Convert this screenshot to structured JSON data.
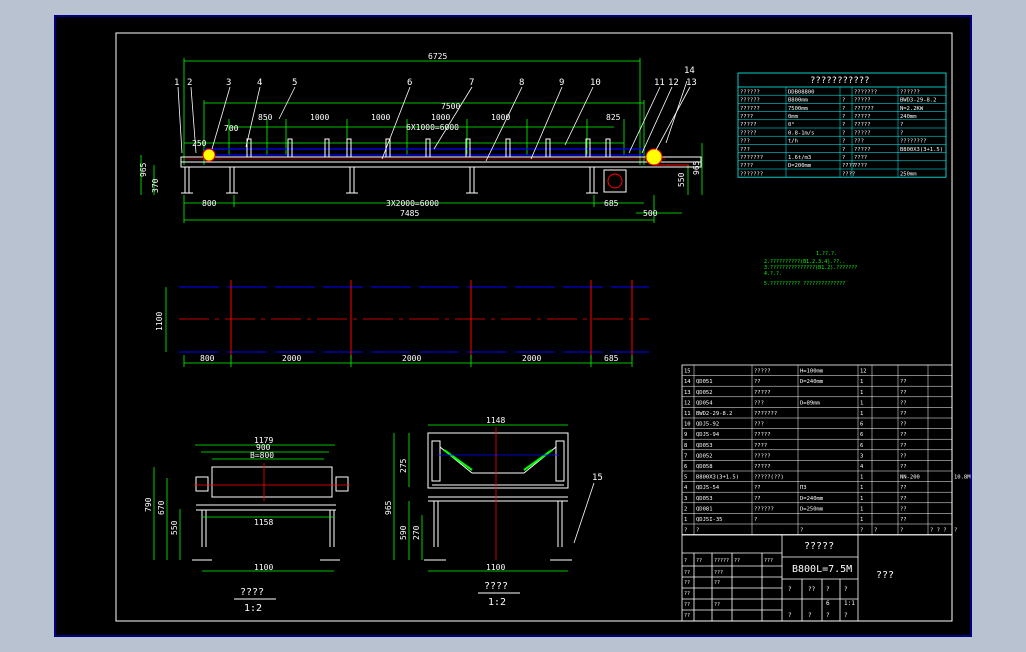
{
  "colors": {
    "background": "#000000",
    "frame": "#ffffff",
    "accent_green": "#00ff00",
    "accent_red": "#ff0000",
    "accent_blue": "#0000ff",
    "accent_cyan": "#00ffff",
    "accent_yellow": "#ffff00",
    "border_blue": "#0000ff"
  },
  "main_view": {
    "dims": {
      "d6725": "6725",
      "d7500": "7500",
      "d6x1000": "6X1000=6000",
      "d250": "250",
      "d700": "700",
      "d850": "850",
      "d1000a": "1000",
      "d1000b": "1000",
      "d1000c": "1000",
      "d1000d": "1000",
      "d825": "825",
      "d965_left": "965",
      "d370": "370",
      "d550": "550",
      "d965_right": "965",
      "d800": "800",
      "d3x2000": "3X2000=6000",
      "d685": "685",
      "d7485": "7485",
      "d500": "500"
    },
    "callouts": [
      "1",
      "2",
      "3",
      "4",
      "5",
      "6",
      "7",
      "8",
      "9",
      "10",
      "11",
      "12",
      "13",
      "14"
    ]
  },
  "plan_view": {
    "d1100": "1100",
    "d800": "800",
    "d2000a": "2000",
    "d2000b": "2000",
    "d2000c": "2000",
    "d685": "685"
  },
  "end_view_a": {
    "d1179": "1179",
    "d900": "900",
    "dB800": "B=800",
    "d790": "790",
    "d670": "670",
    "d550": "550",
    "d1158": "1158",
    "d1100": "1100",
    "title": "????",
    "scale": "1:2"
  },
  "end_view_b": {
    "d1148": "1148",
    "d275": "275",
    "d965": "965",
    "d590": "590",
    "d270": "270",
    "d1100": "1100",
    "callout15": "15",
    "title": "????",
    "scale": "1:2"
  },
  "params_table": {
    "title": "???????????",
    "rows": [
      [
        "??????",
        "DDB08800",
        "",
        "???????",
        "??????"
      ],
      [
        "??????",
        "B800mm",
        "?",
        "?????",
        "BWD3-29-8.2"
      ],
      [
        "??????",
        "7500mm",
        "?",
        "??????",
        "N=2.2KW"
      ],
      [
        "????",
        "0mm",
        "?",
        "?????",
        "240mm"
      ],
      [
        "?????",
        "0°",
        "?",
        "?????",
        "?"
      ],
      [
        "?????",
        "0.8-1m/s",
        "?",
        "?????",
        "?"
      ],
      [
        "???",
        "t/h",
        "?",
        "???",
        "????????"
      ],
      [
        "???",
        "",
        "?",
        "?????",
        "B800X3(3+1.5)"
      ],
      [
        "???????",
        "1.6t/m3",
        "?",
        "????",
        ""
      ],
      [
        "????",
        "D=200mm",
        "????",
        "????",
        ""
      ],
      [
        "???????",
        "",
        "????",
        "",
        "250mm"
      ]
    ]
  },
  "notes": [
    "1.??.?.",
    "2.??????????(B1.2.3.4).??..",
    "3.???????????????(B1.2).???????",
    "4.?.?.",
    "5.?????????? ??????????????"
  ],
  "parts_list": {
    "rows": [
      [
        "15",
        "",
        "?????",
        "H=100mm",
        "12",
        "",
        "",
        "",
        ""
      ],
      [
        "14",
        "QD051",
        "??",
        "D=240mm",
        "1",
        "",
        "??",
        "",
        ""
      ],
      [
        "13",
        "QD052",
        "?????",
        "",
        "1",
        "",
        "??",
        "",
        ""
      ],
      [
        "12",
        "QD054",
        "???",
        "D=89mm",
        "1",
        "",
        "??",
        "",
        ""
      ],
      [
        "11",
        "BWD2-29-8.2",
        "???????",
        "",
        "1",
        "",
        "??",
        "",
        ""
      ],
      [
        "10",
        "QDJ5-92",
        "???",
        "",
        "6",
        "",
        "??",
        "",
        ""
      ],
      [
        "9",
        "QDJ5-94",
        "?????",
        "",
        "6",
        "",
        "??",
        "",
        ""
      ],
      [
        "8",
        "QD053",
        "????",
        "",
        "6",
        "",
        "??",
        "",
        ""
      ],
      [
        "7",
        "QD052",
        "?????",
        "",
        "3",
        "",
        "??",
        "",
        ""
      ],
      [
        "6",
        "QD058",
        "?????",
        "",
        "4",
        "",
        "??",
        "",
        ""
      ],
      [
        "5",
        "B800X3(3+1.5)",
        "?????(??)",
        "",
        "1",
        "",
        "NN-200",
        "",
        "10.8M"
      ],
      [
        "4",
        "QDJ5-54",
        "??",
        "ПЗ",
        "1",
        "",
        "??",
        "",
        ""
      ],
      [
        "3",
        "QD053",
        "??",
        "D=240mm",
        "1",
        "",
        "??",
        "",
        ""
      ],
      [
        "2",
        "QD081",
        "??????",
        "D=250mm",
        "1",
        "",
        "??",
        "",
        ""
      ],
      [
        "1",
        "QDJ5I-35",
        "?",
        "",
        "1",
        "",
        "??",
        "",
        ""
      ],
      [
        "?",
        "?",
        "",
        "?",
        "?",
        "?",
        "?",
        "? ? ?",
        "?"
      ]
    ]
  },
  "title_block": {
    "name": "?????",
    "model": "B800L=7.5M",
    "company": "???",
    "left_cells": [
      [
        "?",
        "??",
        "?????",
        "??",
        "???"
      ],
      [
        "??",
        "",
        "???",
        "",
        ""
      ],
      [
        "??",
        "",
        "??",
        "",
        ""
      ],
      [
        "??",
        "",
        "",
        "",
        ""
      ],
      [
        "??",
        "",
        "??",
        "",
        ""
      ],
      [
        "??",
        "",
        "",
        "",
        ""
      ]
    ],
    "right_cells": [
      [
        "?",
        "??",
        "?",
        "?"
      ],
      [
        "",
        "",
        "6",
        "1:1"
      ],
      [
        "?",
        "?",
        "?",
        "?"
      ]
    ]
  }
}
